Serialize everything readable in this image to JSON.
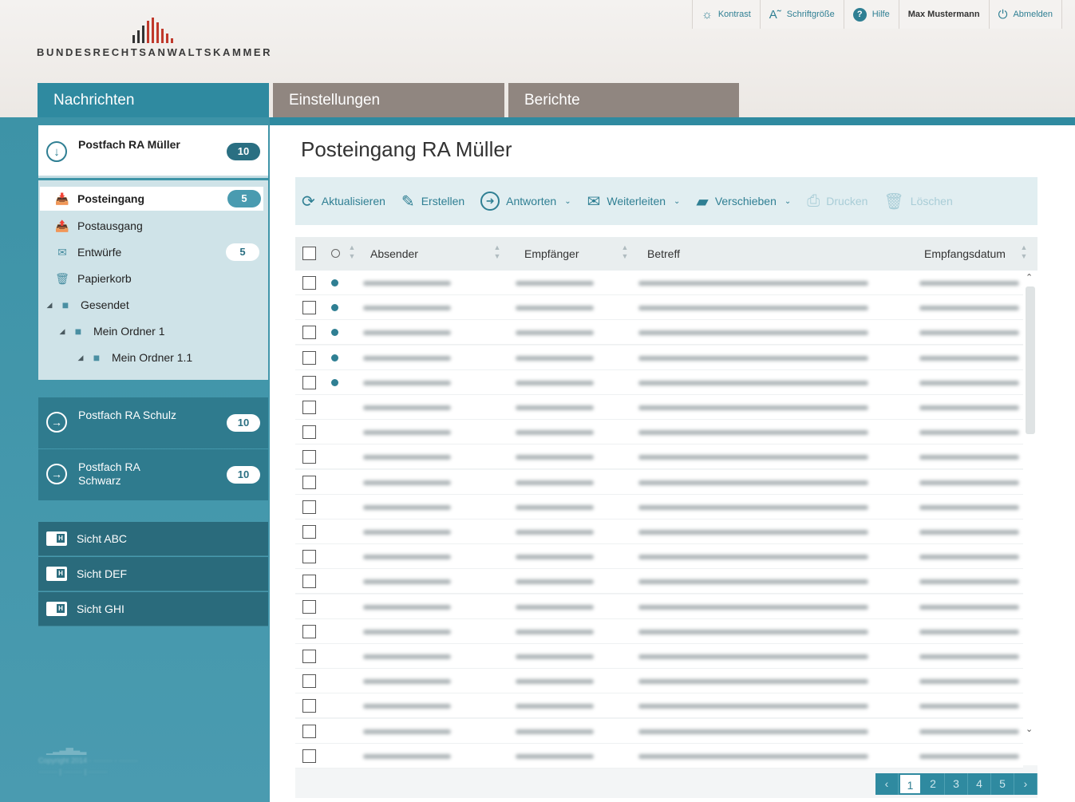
{
  "header": {
    "logo_text": "BUNDESRECHTSANWALTSKAMMER",
    "topbar": {
      "kontrast": "Kontrast",
      "schriftgroesse": "Schriftgröße",
      "hilfe": "Hilfe",
      "user": "Max Mustermann",
      "abmelden": "Abmelden"
    },
    "tabs": [
      "Nachrichten",
      "Einstellungen",
      "Berichte"
    ]
  },
  "sidebar": {
    "active_mailbox": {
      "label": "Postfach RA Müller",
      "count": "10"
    },
    "folders": [
      {
        "label": "Posteingang",
        "count": "5",
        "icon": "inbox-icon"
      },
      {
        "label": "Postausgang",
        "count": "",
        "icon": "outbox-icon"
      },
      {
        "label": "Entwürfe",
        "count": "5",
        "icon": "drafts-icon"
      },
      {
        "label": "Papierkorb",
        "count": "",
        "icon": "trash-icon"
      },
      {
        "label": "Gesendet",
        "count": "",
        "icon": "folder-icon"
      },
      {
        "label": "Mein Ordner 1",
        "count": "",
        "icon": "folder-icon"
      },
      {
        "label": "Mein Ordner 1.1",
        "count": "",
        "icon": "folder-icon"
      }
    ],
    "other_mailboxes": [
      {
        "label": "Postfach RA Schulz",
        "count": "10"
      },
      {
        "label": "Postfach RA Schwarz",
        "count": "10"
      }
    ],
    "views": [
      "Sicht ABC",
      "Sicht DEF",
      "Sicht GHI"
    ]
  },
  "main": {
    "title": "Posteingang RA Müller",
    "toolbar": {
      "aktualisieren": "Aktualisieren",
      "erstellen": "Erstellen",
      "antworten": "Antworten",
      "weiterleiten": "Weiterleiten",
      "verschieben": "Verschieben",
      "drucken": "Drucken",
      "loeschen": "Löschen"
    },
    "columns": {
      "absender": "Absender",
      "empfaenger": "Empfänger",
      "betreff": "Betreff",
      "empfangsdatum": "Empfangsdatum"
    },
    "rows_unread": [
      true,
      true,
      true,
      true,
      true,
      false,
      false,
      false,
      false,
      false,
      false,
      false,
      false,
      false,
      false,
      false,
      false,
      false,
      false,
      false
    ],
    "pagination": [
      "1",
      "2",
      "3",
      "4",
      "5"
    ],
    "current_page": "1"
  },
  "colors": {
    "accent": "#2f8aa0",
    "tab_inactive": "#908680",
    "sidebar_dark": "#2a6b7c"
  }
}
